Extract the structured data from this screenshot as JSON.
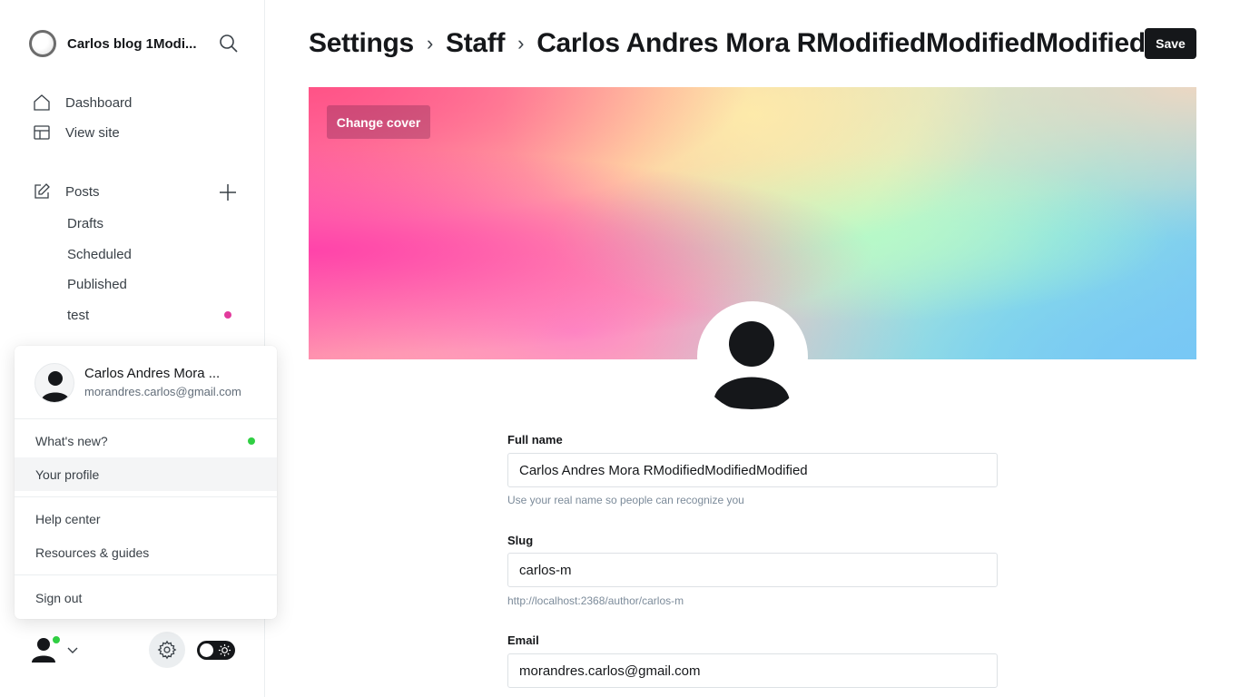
{
  "sidebar": {
    "site_title": "Carlos blog 1Modi...",
    "nav": {
      "dashboard": "Dashboard",
      "view_site": "View site",
      "posts": "Posts",
      "drafts": "Drafts",
      "scheduled": "Scheduled",
      "published": "Published",
      "test": "test"
    },
    "colors": {
      "tag_dot": "#e23a9c",
      "online_dot": "#30cf43"
    }
  },
  "user_menu": {
    "name": "Carlos Andres Mora ...",
    "email": "morandres.carlos@gmail.com",
    "whats_new": "What's new?",
    "your_profile": "Your profile",
    "help_center": "Help center",
    "resources": "Resources & guides",
    "sign_out": "Sign out"
  },
  "header": {
    "crumb_settings": "Settings",
    "crumb_staff": "Staff",
    "crumb_user": "Carlos Andres Mora RModifiedModifiedModified",
    "separator": "›",
    "save_label": "Save"
  },
  "cover": {
    "change_cover_label": "Change cover"
  },
  "form": {
    "full_name_label": "Full name",
    "full_name_value": "Carlos Andres Mora RModifiedModifiedModified",
    "full_name_hint": "Use your real name so people can recognize you",
    "slug_label": "Slug",
    "slug_value": "carlos-m",
    "slug_hint": "http://localhost:2368/author/carlos-m",
    "email_label": "Email",
    "email_value": "morandres.carlos@gmail.com"
  },
  "icons": {
    "search": "search-icon",
    "home": "home-icon",
    "view_site": "layout-icon",
    "posts": "edit-icon",
    "plus": "plus-icon",
    "gear": "gear-icon",
    "sun": "sun-icon",
    "chevron": "chevron-down-icon",
    "avatar": "user-avatar-icon"
  }
}
